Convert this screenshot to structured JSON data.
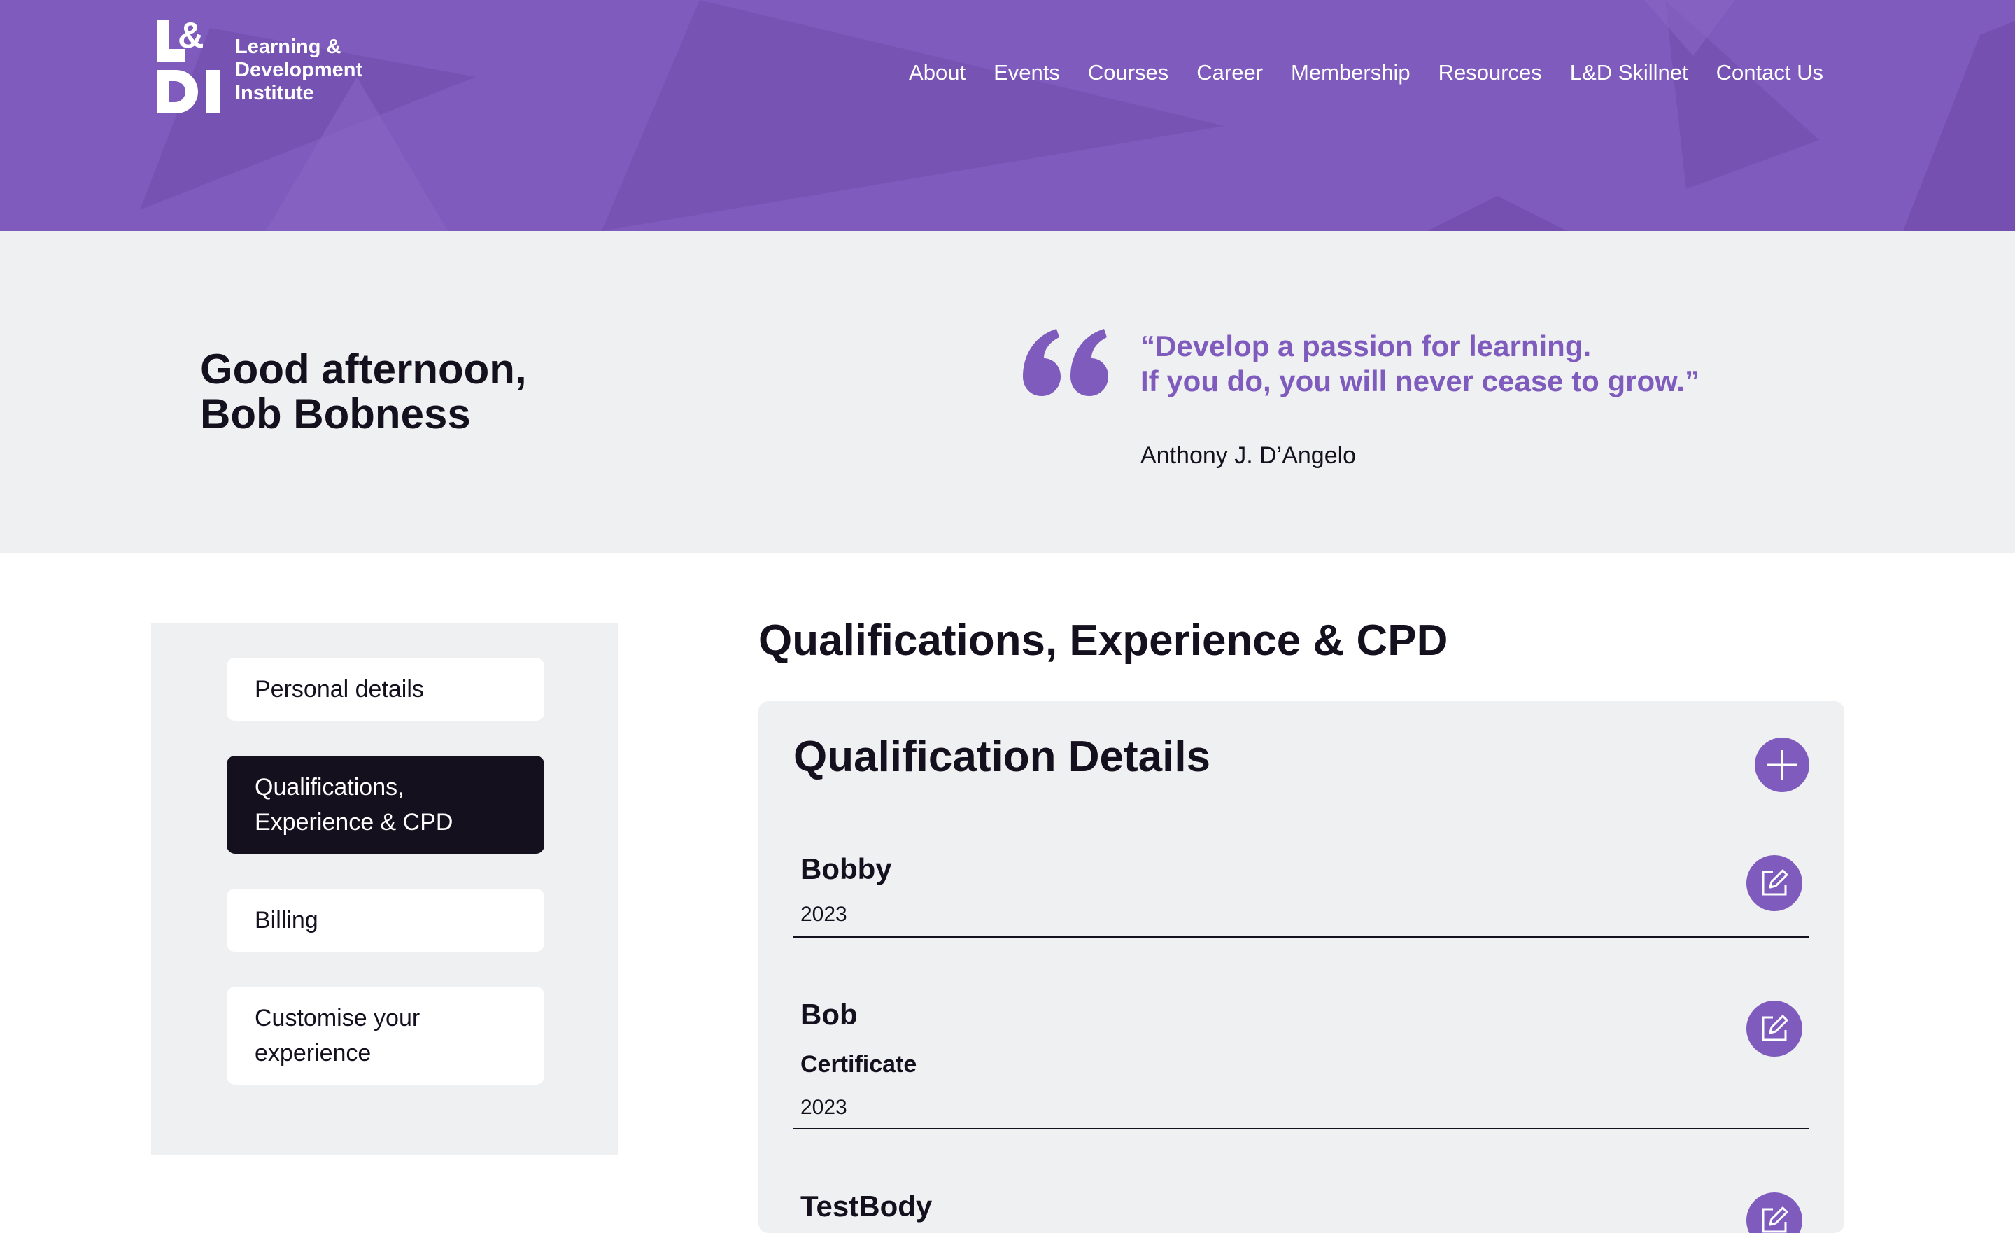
{
  "header": {
    "logo_text_line1": "Learning &",
    "logo_text_line2": "Development",
    "logo_text_line3": "Institute",
    "logo_mark": "L&DI",
    "nav": [
      "About",
      "Events",
      "Courses",
      "Career",
      "Membership",
      "Resources",
      "L&D Skillnet",
      "Contact Us"
    ]
  },
  "greeting": {
    "line1": "Good afternoon,",
    "line2": "Bob Bobness"
  },
  "quote": {
    "text": "“Develop a passion for learning.\nIf you do, you will never cease to grow.”",
    "author": "Anthony J. D’Angelo",
    "icon": "quote-icon"
  },
  "sidebar": {
    "items": [
      {
        "label": "Personal details",
        "active": false
      },
      {
        "label": "Qualifications,\nExperience & CPD",
        "active": true
      },
      {
        "label": "Billing",
        "active": false
      },
      {
        "label": "Customise your\nexperience",
        "active": false
      }
    ]
  },
  "main": {
    "title": "Qualifications, Experience & CPD",
    "card_title": "Qualification Details",
    "add_icon": "plus-icon",
    "edit_icon": "edit-icon",
    "qualifications": [
      {
        "name": "Bobby",
        "type": "",
        "year": "2023"
      },
      {
        "name": "Bob",
        "type": "Certificate",
        "year": "2023"
      },
      {
        "name": "TestBody",
        "type": "",
        "year": ""
      }
    ]
  },
  "colors": {
    "brand_purple": "#7e5bbd",
    "dark": "#14101e",
    "light_gray": "#eff0f2"
  }
}
